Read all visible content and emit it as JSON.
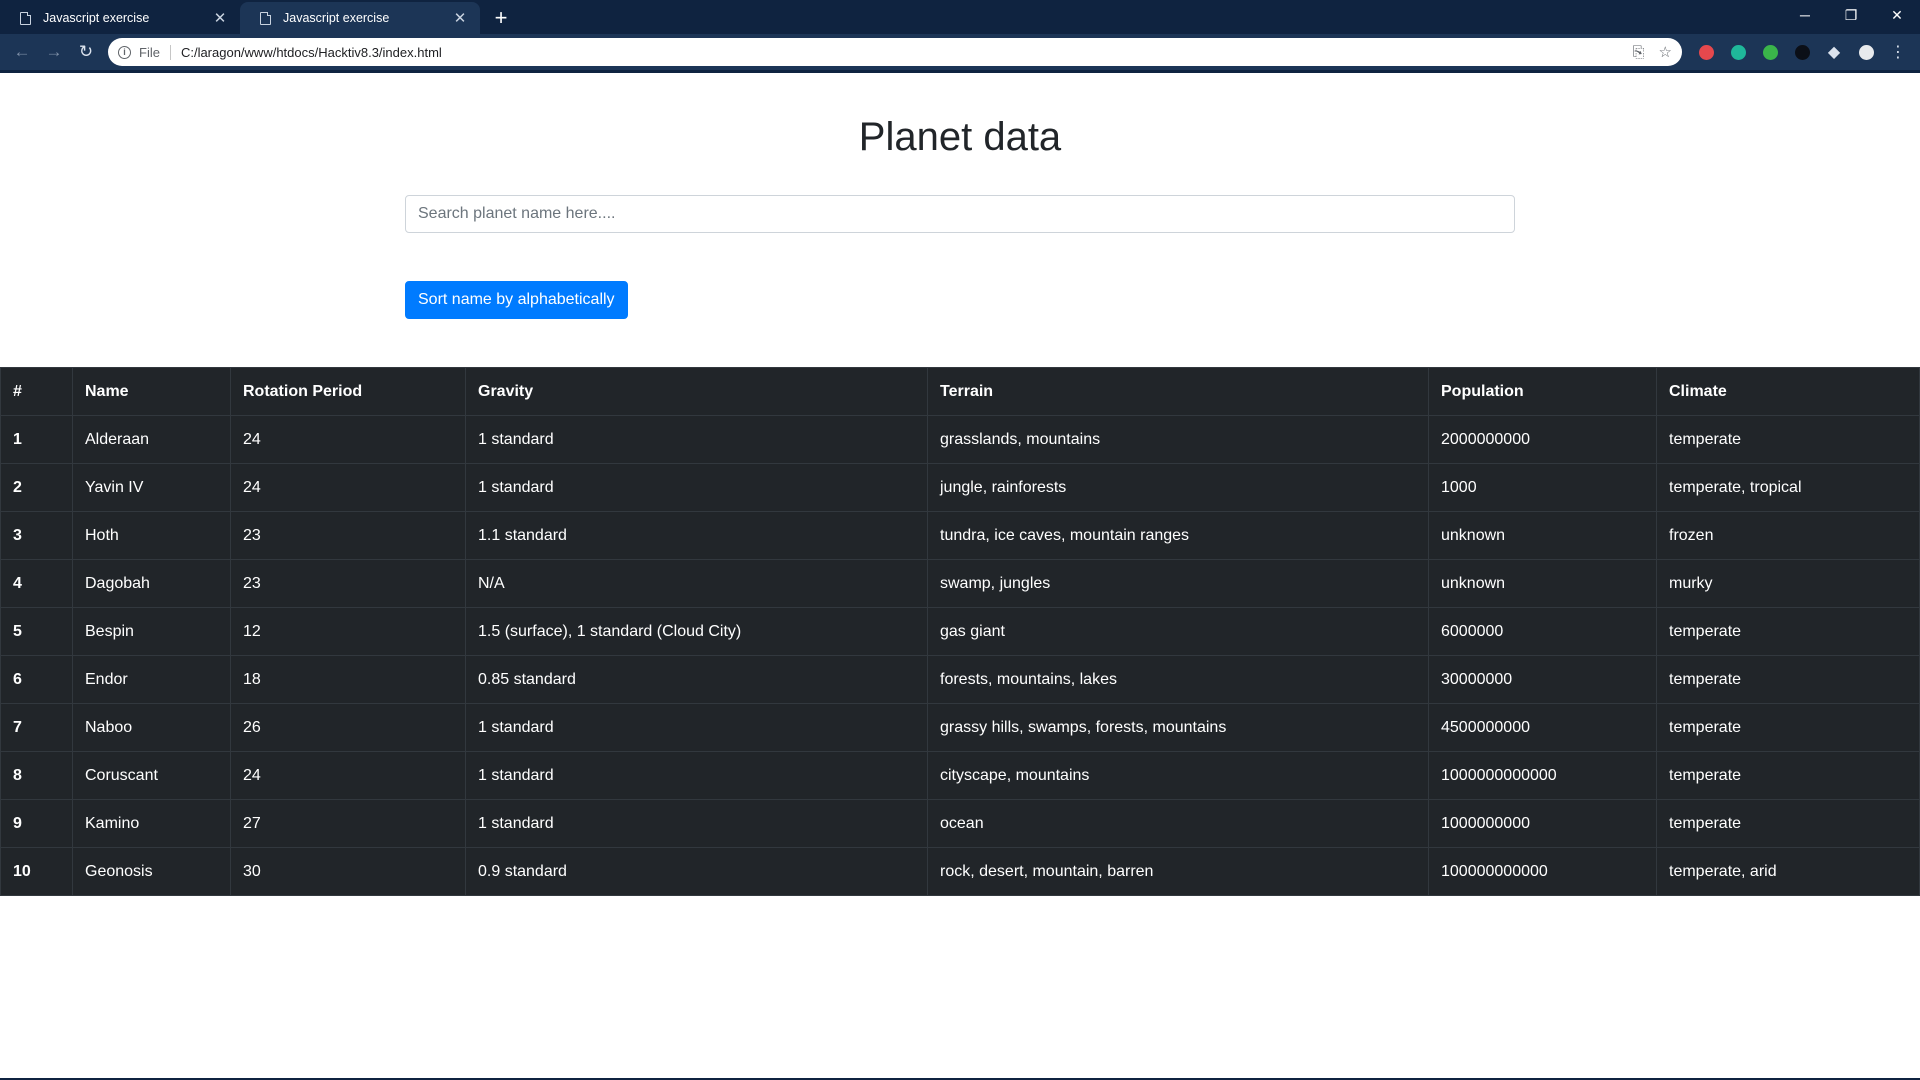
{
  "browser": {
    "tabs": [
      {
        "title": "Javascript exercise",
        "active": false
      },
      {
        "title": "Javascript exercise",
        "active": true
      }
    ],
    "scheme_label": "File",
    "url": "C:/laragon/www/htdocs/Hacktiv8.3/index.html"
  },
  "page": {
    "title": "Planet data",
    "search_placeholder": "Search planet name here....",
    "sort_button_label": "Sort name by alphabetically"
  },
  "table": {
    "headers": [
      "#",
      "Name",
      "Rotation Period",
      "Gravity",
      "Terrain",
      "Population",
      "Climate"
    ],
    "rows": [
      [
        "1",
        "Alderaan",
        "24",
        "1 standard",
        "grasslands, mountains",
        "2000000000",
        "temperate"
      ],
      [
        "2",
        "Yavin IV",
        "24",
        "1 standard",
        "jungle, rainforests",
        "1000",
        "temperate, tropical"
      ],
      [
        "3",
        "Hoth",
        "23",
        "1.1 standard",
        "tundra, ice caves, mountain ranges",
        "unknown",
        "frozen"
      ],
      [
        "4",
        "Dagobah",
        "23",
        "N/A",
        "swamp, jungles",
        "unknown",
        "murky"
      ],
      [
        "5",
        "Bespin",
        "12",
        "1.5 (surface), 1 standard (Cloud City)",
        "gas giant",
        "6000000",
        "temperate"
      ],
      [
        "6",
        "Endor",
        "18",
        "0.85 standard",
        "forests, mountains, lakes",
        "30000000",
        "temperate"
      ],
      [
        "7",
        "Naboo",
        "26",
        "1 standard",
        "grassy hills, swamps, forests, mountains",
        "4500000000",
        "temperate"
      ],
      [
        "8",
        "Coruscant",
        "24",
        "1 standard",
        "cityscape, mountains",
        "1000000000000",
        "temperate"
      ],
      [
        "9",
        "Kamino",
        "27",
        "1 standard",
        "ocean",
        "1000000000",
        "temperate"
      ],
      [
        "10",
        "Geonosis",
        "30",
        "0.9 standard",
        "rock, desert, mountain, barren",
        "100000000000",
        "temperate, arid"
      ]
    ]
  },
  "colors": {
    "primary_button": "#007bff",
    "table_dark": "#212529",
    "browser_frame": "#0f2340"
  },
  "icons": [
    "document-icon",
    "close-icon",
    "plus-icon",
    "minimize-icon",
    "restore-icon",
    "window-close-icon",
    "back-icon",
    "forward-icon",
    "reload-icon",
    "info-icon",
    "translate-icon",
    "star-icon",
    "extension-icon",
    "profile-avatar-icon",
    "menu-icon"
  ]
}
